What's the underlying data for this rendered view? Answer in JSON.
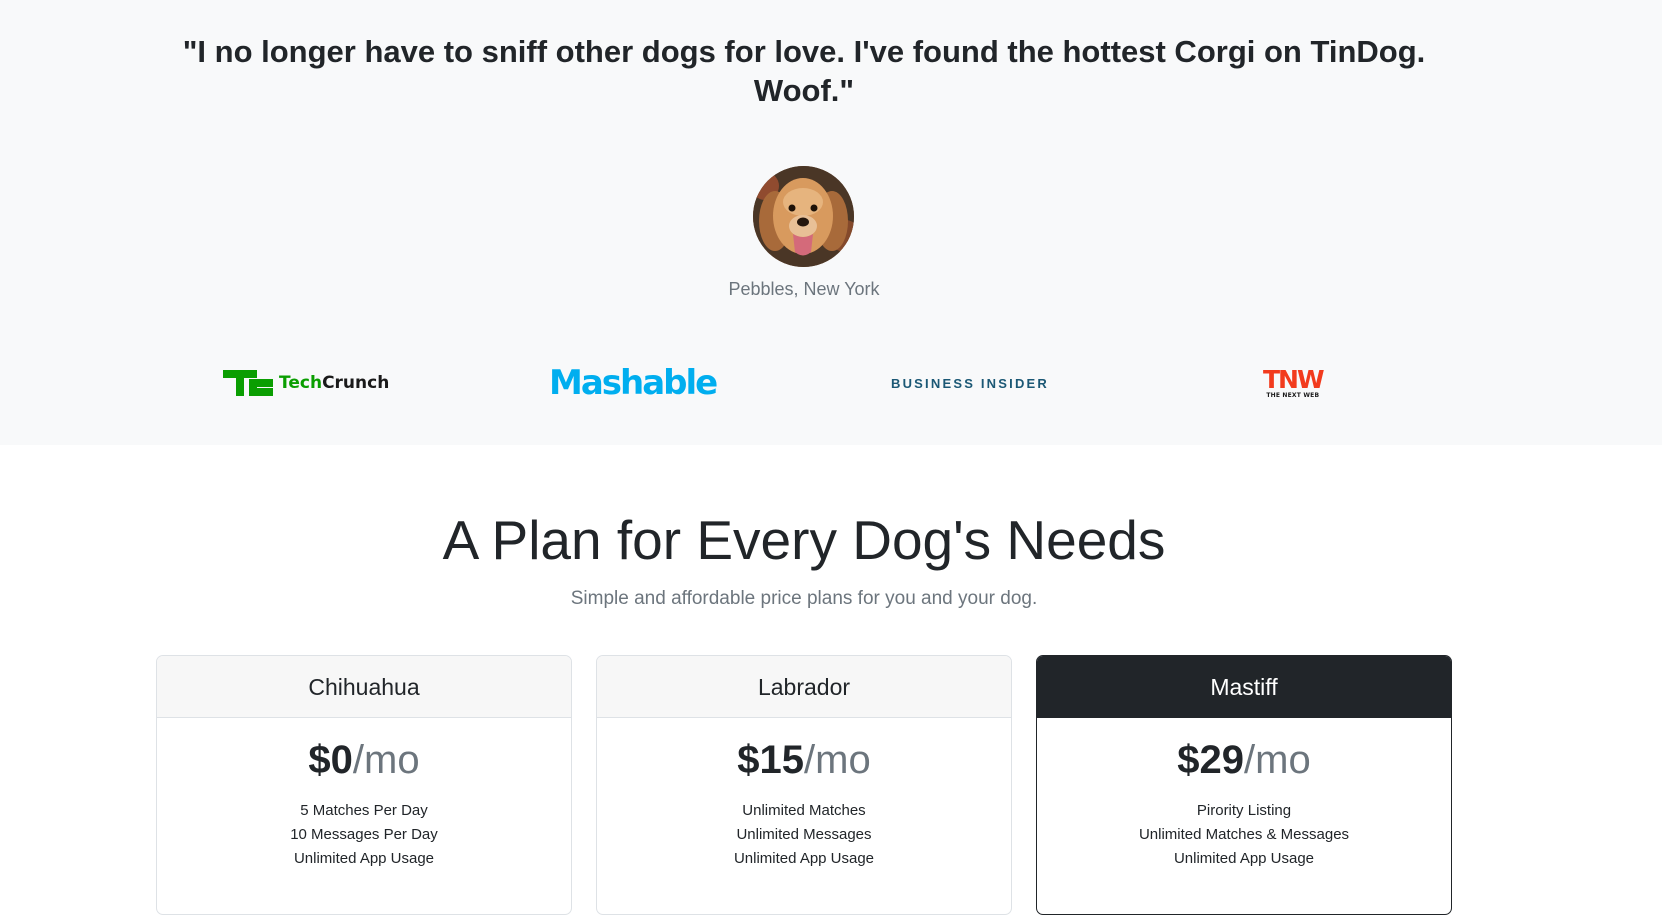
{
  "testimonial": {
    "quote": "\"I no longer have to sniff other dogs for love. I've found the hottest Corgi on TinDog. Woof.\"",
    "author": "Pebbles, New York",
    "avatar_icon": "dog-avatar"
  },
  "press": {
    "techcrunch": {
      "tech": "Tech",
      "crunch": "Crunch",
      "color": "#0a9e01"
    },
    "mashable": {
      "text": "Mashable",
      "color": "#00aeef"
    },
    "business_insider": {
      "text": "BUSINESS INSIDER",
      "color": "#1b5875"
    },
    "tnw": {
      "big": "TNW",
      "small": "THE NEXT WEB",
      "color": "#f23b1d"
    }
  },
  "pricing": {
    "title": "A Plan for Every Dog's Needs",
    "subtitle": "Simple and affordable price plans for you and your dog.",
    "plans": [
      {
        "name": "Chihuahua",
        "price": "$0",
        "unit": "/mo",
        "features": [
          "5 Matches Per Day",
          "10 Messages Per Day",
          "Unlimited App Usage"
        ]
      },
      {
        "name": "Labrador",
        "price": "$15",
        "unit": "/mo",
        "features": [
          "Unlimited Matches",
          "Unlimited Messages",
          "Unlimited App Usage"
        ]
      },
      {
        "name": "Mastiff",
        "price": "$29",
        "unit": "/mo",
        "features": [
          "Pirority Listing",
          "Unlimited Matches & Messages",
          "Unlimited App Usage"
        ]
      }
    ]
  },
  "colors": {
    "section_bg": "#f8f9fa",
    "dark": "#212529",
    "muted": "#6c757d"
  }
}
